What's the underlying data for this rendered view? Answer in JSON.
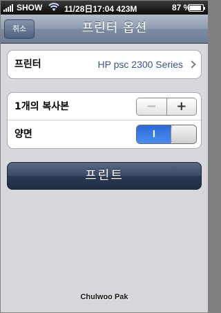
{
  "status_bar": {
    "carrier": "SHOW",
    "datetime": "11/28日17:04 423M",
    "battery_percent_label": "87 %",
    "battery_level": 0.87,
    "signal_bars": 5
  },
  "navbar": {
    "cancel_label": "취소",
    "title": "프린터 옵션"
  },
  "printer_section": {
    "label": "프린터",
    "value": "HP psc 2300 Series"
  },
  "copies_section": {
    "label": "1개의 복사본",
    "minus_label": "−",
    "plus_label": "+",
    "copies": 1
  },
  "duplex_section": {
    "label": "양면",
    "toggle_on_label": "I",
    "enabled": true
  },
  "print_button": {
    "label": "프린트"
  },
  "watermark": "Chulwoo Pak",
  "colors": {
    "background": "#d6d8dc",
    "navbar": "#8d9bb0",
    "print_button": "#2b3a55",
    "value_text": "#385487",
    "toggle_on": "#2c68d8"
  }
}
